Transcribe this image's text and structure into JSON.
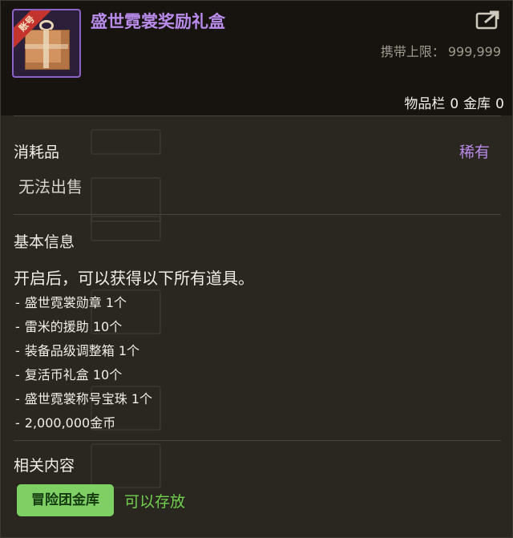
{
  "header": {
    "title": "盛世霓裳奖励礼盒",
    "badge": "账号",
    "carry_label": "携带上限：",
    "carry_value": "999,999",
    "inventory_label": "物品栏",
    "inventory_count": "0",
    "vault_label": "金库",
    "vault_count": "0",
    "icon": "gift-box-icon",
    "share_icon": "share-icon"
  },
  "meta": {
    "category": "消耗品",
    "rarity": "稀有",
    "sellable": "无法出售"
  },
  "basic_info": {
    "title": "基本信息",
    "description": "开启后，可以获得以下所有道具。",
    "items": [
      {
        "dash": "-",
        "text": "盛世霓裳勋章 1个"
      },
      {
        "dash": "-",
        "text": "雷米的援助 10个"
      },
      {
        "dash": "-",
        "text": "装备品级调整箱 1个"
      },
      {
        "dash": "-",
        "text": "复活币礼盒 10个"
      },
      {
        "dash": "-",
        "text": "盛世霓裳称号宝珠 1个"
      },
      {
        "dash": "-",
        "text": "2,000,000金币"
      }
    ]
  },
  "related": {
    "title": "相关内容",
    "vault_button": "冒险团金库",
    "vault_status": "可以存放"
  },
  "colors": {
    "rarity_purple": "#b98bea",
    "vault_green": "#7ed065",
    "status_green": "#72d04f"
  }
}
